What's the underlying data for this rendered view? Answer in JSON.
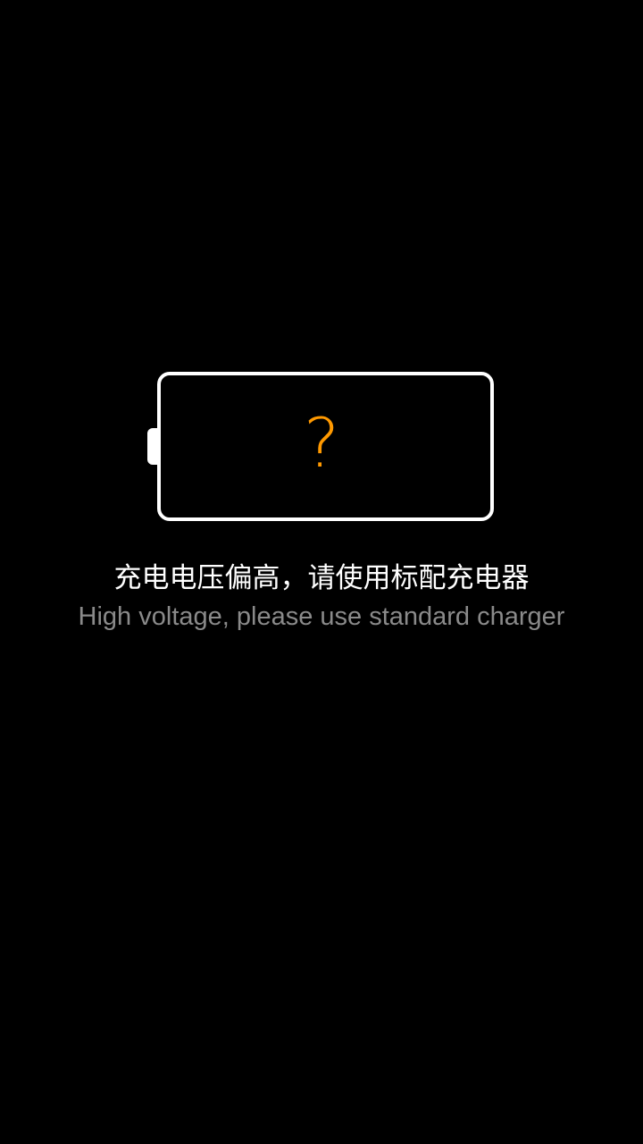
{
  "battery": {
    "icon": "battery-unknown-icon",
    "symbol": "?",
    "symbol_color": "#ff9900",
    "outline_color": "#ffffff"
  },
  "message": {
    "chinese": "充电电压偏高，请使用标配充电器",
    "english": "High voltage, please use standard charger"
  },
  "colors": {
    "background": "#000000",
    "primary_text": "#ffffff",
    "secondary_text": "#8a8a8a"
  }
}
